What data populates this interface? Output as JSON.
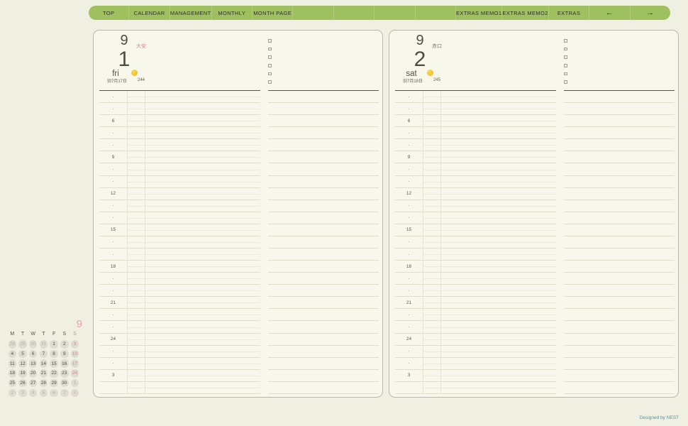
{
  "nav": {
    "background": "#9ec05e",
    "items": [
      {
        "label": "TOP",
        "name": "nav-item-top"
      },
      {
        "label": "CALENDAR",
        "name": "nav-item-calendar"
      },
      {
        "label": "MANAGEMENT",
        "name": "nav-item-management"
      },
      {
        "label": "MONTHLY",
        "name": "nav-item-monthly"
      },
      {
        "label": "MONTH PAGE",
        "name": "nav-item-month-page"
      },
      {
        "label": "",
        "name": "nav-spacer-1"
      },
      {
        "label": "",
        "name": "nav-spacer-2"
      },
      {
        "label": "",
        "name": "nav-spacer-3"
      },
      {
        "label": "",
        "name": "nav-spacer-4"
      },
      {
        "label": "EXTRAS MEMO1",
        "name": "nav-item-extras-memo1"
      },
      {
        "label": "EXTRAS MEMO2",
        "name": "nav-item-extras-memo2"
      },
      {
        "label": "EXTRAS",
        "name": "nav-item-extras"
      },
      {
        "label": "←",
        "name": "nav-arrow-previous",
        "arrow": true
      },
      {
        "label": "→",
        "name": "nav-arrow-next",
        "arrow": true
      }
    ]
  },
  "pages": [
    {
      "side": "left",
      "month": "9",
      "rokuyo": "大安",
      "rokuyo_color": "#dd8793",
      "day": "1",
      "weekday": "fri",
      "lunar_date": "旧7月17日",
      "day_of_year": "244"
    },
    {
      "side": "right",
      "month": "9",
      "rokuyo": "赤口",
      "rokuyo_color": "#73736a",
      "day": "2",
      "weekday": "sat",
      "lunar_date": "旧7月18日",
      "day_of_year": "245"
    }
  ],
  "hour_labels": [
    "·",
    "·",
    "6",
    "·",
    "·",
    "9",
    "·",
    "·",
    "12",
    "·",
    "·",
    "15",
    "·",
    "·",
    "18",
    "·",
    "·",
    "21",
    "·",
    "·",
    "24",
    "·",
    "·",
    "3",
    ""
  ],
  "todo_checkbox_count": 6,
  "notes_line_count": 25,
  "mini_calendar": {
    "month": "9",
    "weekday_headers": [
      {
        "label": "M",
        "type": "weekday"
      },
      {
        "label": "T",
        "type": "weekday"
      },
      {
        "label": "W",
        "type": "weekday"
      },
      {
        "label": "T",
        "type": "weekday"
      },
      {
        "label": "F",
        "type": "weekday"
      },
      {
        "label": "S",
        "type": "weekday"
      },
      {
        "label": "S",
        "type": "sunday"
      }
    ],
    "rows": [
      [
        {
          "d": "28",
          "t": "adjacent"
        },
        {
          "d": "29",
          "t": "adjacent"
        },
        {
          "d": "30",
          "t": "adjacent"
        },
        {
          "d": "31",
          "t": "adjacent"
        },
        {
          "d": "1",
          "t": "current"
        },
        {
          "d": "2",
          "t": "current"
        },
        {
          "d": "3",
          "t": "sunday"
        }
      ],
      [
        {
          "d": "4",
          "t": "current"
        },
        {
          "d": "5",
          "t": "current"
        },
        {
          "d": "6",
          "t": "current"
        },
        {
          "d": "7",
          "t": "current"
        },
        {
          "d": "8",
          "t": "current"
        },
        {
          "d": "9",
          "t": "current"
        },
        {
          "d": "10",
          "t": "sunday"
        }
      ],
      [
        {
          "d": "11",
          "t": "current"
        },
        {
          "d": "12",
          "t": "current"
        },
        {
          "d": "13",
          "t": "current"
        },
        {
          "d": "14",
          "t": "current"
        },
        {
          "d": "15",
          "t": "current"
        },
        {
          "d": "16",
          "t": "current"
        },
        {
          "d": "17",
          "t": "sunday"
        }
      ],
      [
        {
          "d": "18",
          "t": "current"
        },
        {
          "d": "19",
          "t": "current"
        },
        {
          "d": "20",
          "t": "current"
        },
        {
          "d": "21",
          "t": "current"
        },
        {
          "d": "22",
          "t": "current"
        },
        {
          "d": "23",
          "t": "current"
        },
        {
          "d": "24",
          "t": "sunday"
        }
      ],
      [
        {
          "d": "25",
          "t": "current"
        },
        {
          "d": "26",
          "t": "current"
        },
        {
          "d": "27",
          "t": "current"
        },
        {
          "d": "28",
          "t": "current"
        },
        {
          "d": "29",
          "t": "current"
        },
        {
          "d": "30",
          "t": "current"
        },
        {
          "d": "1",
          "t": "adjacent"
        }
      ],
      [
        {
          "d": "2",
          "t": "adjacent"
        },
        {
          "d": "3",
          "t": "adjacent"
        },
        {
          "d": "4",
          "t": "adjacent"
        },
        {
          "d": "5",
          "t": "adjacent"
        },
        {
          "d": "6",
          "t": "adjacent"
        },
        {
          "d": "7",
          "t": "adjacent"
        },
        {
          "d": "8",
          "t": "adjacent-sunday"
        }
      ]
    ]
  },
  "footer": {
    "credit": "Designed by NEST"
  },
  "colors": {
    "nav_green": "#9ec05e",
    "page_bg": "#f7f7eb",
    "canvas_bg": "#eff0e1",
    "pink_accent": "#d9848f",
    "credit_teal": "#4e97a6",
    "moon_yellow": "#f0c636"
  }
}
